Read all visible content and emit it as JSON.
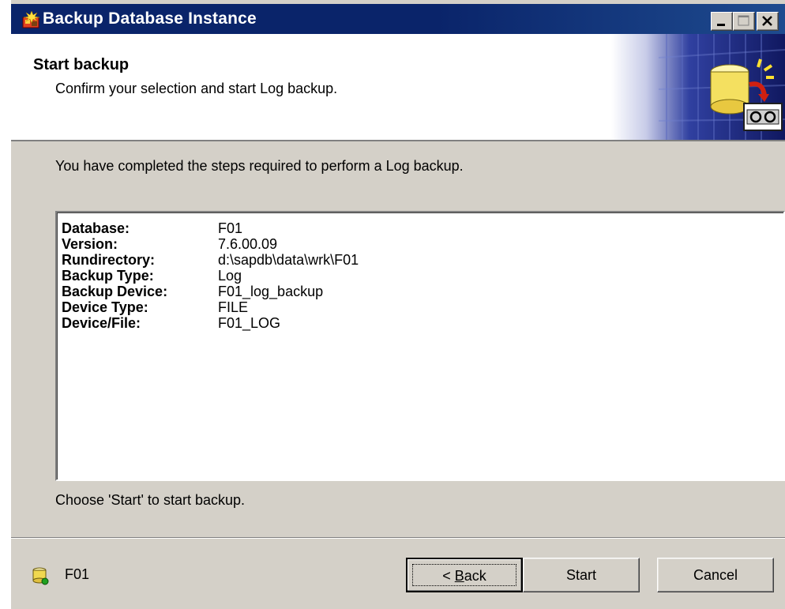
{
  "window": {
    "title": "Backup Database Instance",
    "buttons": {
      "minimize": "minimize",
      "maximize": "maximize",
      "close": "close"
    }
  },
  "header": {
    "title": "Start backup",
    "subtitle": "Confirm your selection and start Log backup."
  },
  "intro": "You have completed the steps required to perform a Log backup.",
  "summary": [
    {
      "key": "Database:",
      "value": "F01"
    },
    {
      "key": "Version:",
      "value": "7.6.00.09"
    },
    {
      "key": "Rundirectory:",
      "value": "d:\\sapdb\\data\\wrk\\F01"
    },
    {
      "key": "Backup Type:",
      "value": "Log"
    },
    {
      "key": "Backup Device:",
      "value": "F01_log_backup"
    },
    {
      "key": "Device Type:",
      "value": "FILE"
    },
    {
      "key": "Device/File:",
      "value": "F01_LOG"
    }
  ],
  "hint": "Choose 'Start' to start backup.",
  "footer": {
    "instance_label": "F01",
    "back_prefix": "< ",
    "back_accel": "B",
    "back_rest": "ack",
    "start_label": "Start",
    "cancel_label": "Cancel"
  },
  "icons": {
    "app": "backup-wizard-icon",
    "header_art": "database-backup-tape-icon",
    "instance": "database-instance-icon"
  },
  "colors": {
    "titlebar": "#0a246a",
    "face": "#d4d0c8",
    "header_bg": "#ffffff"
  }
}
